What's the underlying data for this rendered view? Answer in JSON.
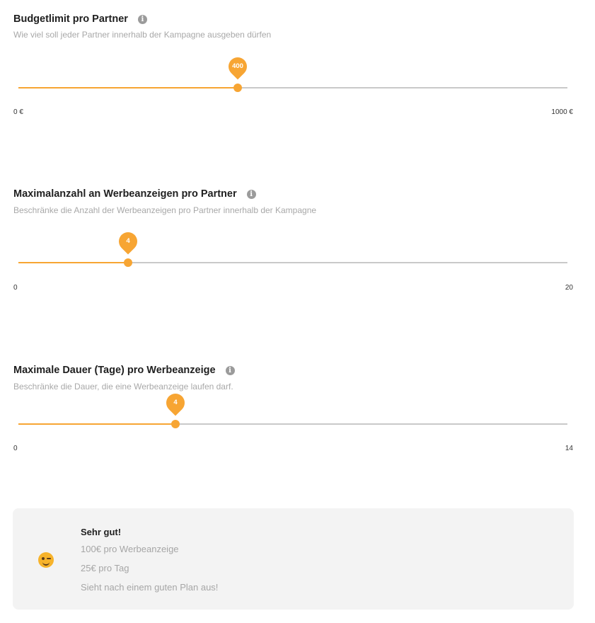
{
  "sections": [
    {
      "title": "Budgetlimit pro Partner",
      "subtitle": "Wie viel soll jeder Partner innerhalb der Kampagne ausgeben dürfen",
      "value": 400,
      "value_label": "400",
      "min": 0,
      "max": 1000,
      "min_label": "0 €",
      "max_label": "1000 €"
    },
    {
      "title": "Maximalanzahl an Werbeanzeigen pro Partner",
      "subtitle": "Beschränke die Anzahl der Werbeanzeigen pro Partner innerhalb der Kampagne",
      "value": 4,
      "value_label": "4",
      "min": 0,
      "max": 20,
      "min_label": "0",
      "max_label": "20"
    },
    {
      "title": "Maximale Dauer (Tage) pro Werbeanzeige",
      "subtitle": "Beschränke die Dauer, die eine Werbeanzeige laufen darf.",
      "value": 4,
      "value_label": "4",
      "min": 0,
      "max": 14,
      "min_label": "0",
      "max_label": "14"
    }
  ],
  "info_icon_glyph": "i",
  "summary": {
    "emoji": "winking-face",
    "title": "Sehr gut!",
    "lines": [
      "100€ pro Werbeanzeige",
      "25€ pro Tag",
      "Sieht nach einem guten Plan aus!"
    ]
  },
  "colors": {
    "accent": "#f7a533",
    "track": "#c9c9c9",
    "summary_bg": "#f3f3f3"
  }
}
